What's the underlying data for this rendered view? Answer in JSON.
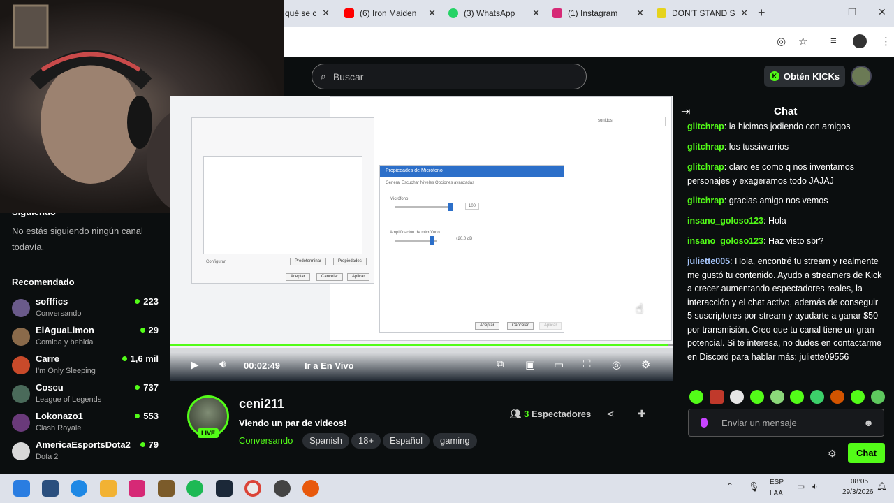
{
  "browser": {
    "tabs": [
      {
        "title": "qué se c",
        "icon": "generic-tab-icon",
        "color": "#777777"
      },
      {
        "title": "(6) Iron Maiden",
        "icon": "youtube-icon",
        "color": "#ff0000"
      },
      {
        "title": "(3) WhatsApp",
        "icon": "whatsapp-icon",
        "color": "#25d366"
      },
      {
        "title": "(1) Instagram",
        "icon": "instagram-icon",
        "color": "#d62976"
      },
      {
        "title": "DON'T STAND S",
        "icon": "star-tab-icon",
        "color": "#e6d31c"
      }
    ],
    "close_glyph": "✕",
    "new_tab_glyph": "+"
  },
  "header": {
    "search_placeholder": "Buscar",
    "kicks_label": "Obtén KICKs"
  },
  "sidebar": {
    "following_title": "Siguiendo",
    "following_empty": "No estás siguiendo ningún canal todavía.",
    "recommended_title": "Recomendado",
    "recommended": [
      {
        "name": "sofffics",
        "category": "Conversando",
        "viewers": "223",
        "color": "#6a5a8a"
      },
      {
        "name": "ElAguaLimon",
        "category": "Comida y bebida",
        "viewers": "29",
        "color": "#8a6a4a"
      },
      {
        "name": "Carre",
        "category": "I'm Only Sleeping",
        "viewers": "1,6 mil",
        "color": "#c84a2a"
      },
      {
        "name": "Coscu",
        "category": "League of Legends",
        "viewers": "737",
        "color": "#4a6a5a"
      },
      {
        "name": "Lokonazo1",
        "category": "Clash Royale",
        "viewers": "553",
        "color": "#6a3a7a"
      },
      {
        "name": "AmericaEsportsDota2",
        "category": "Dota 2",
        "viewers": "79",
        "color": "#d8d8d8"
      }
    ]
  },
  "video": {
    "time": "00:02:49",
    "go_live": "Ir a En Vivo",
    "progress": 0.99,
    "dialog_title": "Propiedades de Micrófono",
    "dialog_tabs": "General   Escuchar   Niveles   Opciones avanzadas",
    "dialog_mic": "Micrófono",
    "dialog_mic_value": "100",
    "dialog_boost": "Amplificación de micrófono",
    "dialog_boost_value": "+20,0 dB",
    "dialog_ok": "Aceptar",
    "dialog_cancel": "Cancelar",
    "dialog_apply": "Aplicar",
    "bg_configure": "Configurar",
    "bg_default": "Predeterminar",
    "bg_properties": "Propiedades",
    "bg_search": "sonidos"
  },
  "channel": {
    "name": "ceni211",
    "live_badge": "LIVE",
    "title": "Viendo un par de videos!",
    "category": "Conversando",
    "tags": [
      "Spanish",
      "18+",
      "Español",
      "gaming"
    ],
    "viewers_count": "3",
    "viewers_label": "Espectadores"
  },
  "chat": {
    "title": "Chat",
    "messages": [
      {
        "user": "glitchrap",
        "text": "la hicimos jodiendo con amigos",
        "color": "#53fc18"
      },
      {
        "user": "glitchrap",
        "text": "los tussiwarrios",
        "color": "#53fc18"
      },
      {
        "user": "glitchrap",
        "text": "claro es como q nos inventamos personajes y exageramos todo JAJAJ",
        "color": "#53fc18"
      },
      {
        "user": "glitchrap",
        "text": "gracias amigo nos vemos",
        "color": "#53fc18"
      },
      {
        "user": "insano_goloso123",
        "text": "Hola",
        "color": "#53fc18"
      },
      {
        "user": "insano_goloso123",
        "text": "Haz visto sbr?",
        "color": "#53fc18"
      },
      {
        "user": "juliette005",
        "text": "Hola, encontré tu stream y realmente me gustó tu contenido. Ayudo a streamers de Kick a crecer aumentando espectadores reales, la interacción y el chat activo, además de conseguir 5 suscriptores por stream y ayudarte a ganar $50 por transmisión. Creo que tu canal tiene un gran potencial. Si te interesa, no dudes en contactarme en Discord para hablar más: juliette09556",
        "color": "#a8c8ff"
      }
    ],
    "input_placeholder": "Enviar un mensaje",
    "send_label": "Chat"
  },
  "taskbar": {
    "lang": "ESP",
    "lang_sub": "LAA",
    "time": "08:05",
    "date": "29/3/2026"
  }
}
